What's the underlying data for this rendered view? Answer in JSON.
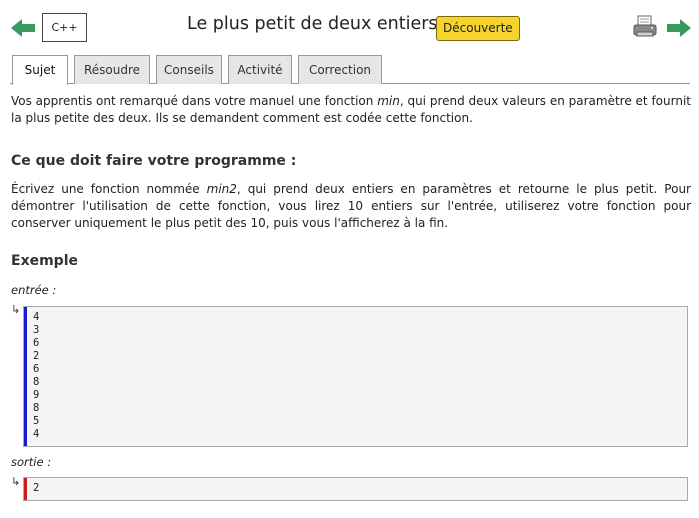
{
  "header": {
    "prev_icon": "arrow-left-icon",
    "next_icon": "arrow-right-icon",
    "print_icon": "printer-icon",
    "language": "C++",
    "title": "Le plus petit de deux entiers",
    "level_badge": "Découverte",
    "colors": {
      "arrow": "#3a9a5b",
      "badge": "#f6d32d"
    }
  },
  "tabs": [
    {
      "label": "Sujet",
      "active": true
    },
    {
      "label": "Résoudre",
      "active": false
    },
    {
      "label": "Conseils",
      "active": false
    },
    {
      "label": "Activité",
      "active": false
    },
    {
      "label": "Correction",
      "active": false
    }
  ],
  "statement": {
    "intro_part1": "Vos apprentis ont remarqué dans votre manuel une fonction ",
    "intro_em": "min",
    "intro_part2": ", qui prend deux valeurs en paramètre et fournit la plus petite des deux. Ils se demandent comment est codée cette fonction.",
    "section_heading": "Ce que doit faire votre programme :",
    "task_part1": "Écrivez une fonction nommée ",
    "task_em": "min2",
    "task_part2": ", qui prend deux entiers en paramètres et retourne le plus petit. Pour démontrer l'utilisation de cette fonction, vous lirez 10 entiers sur l'entrée, utiliserez votre fonction pour conserver uniquement le plus petit des 10, puis vous l'afficherez à la fin."
  },
  "example": {
    "heading": "Exemple",
    "input_label": "entrée :",
    "input_arrow": "↳",
    "input_lines": [
      "4",
      "3",
      "6",
      "2",
      "6",
      "8",
      "9",
      "8",
      "5",
      "4"
    ],
    "output_label": "sortie :",
    "output_arrow": "↳",
    "output_lines": [
      "2"
    ],
    "colors": {
      "input_bar": "#1a1ad0",
      "output_bar": "#d01a1a"
    }
  }
}
